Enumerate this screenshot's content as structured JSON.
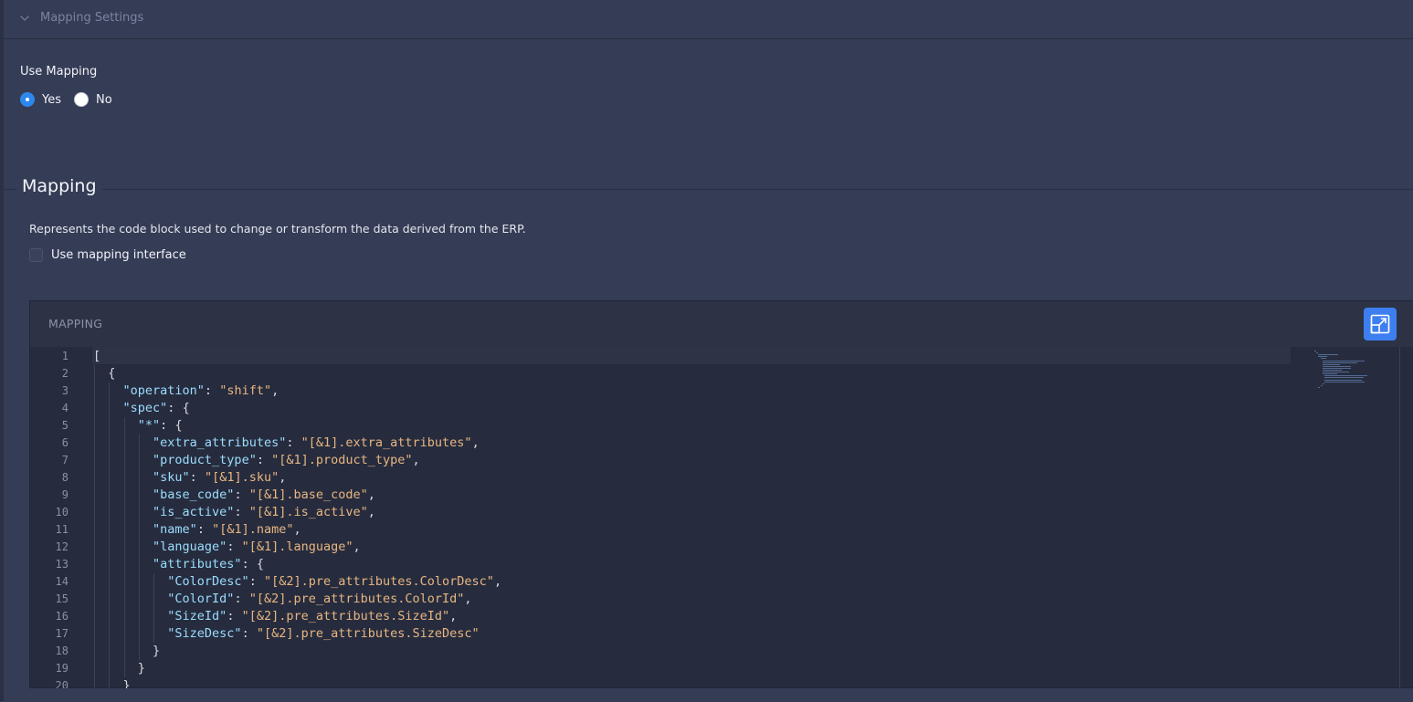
{
  "section": {
    "title": "Mapping Settings"
  },
  "use_mapping": {
    "label": "Use Mapping",
    "options": [
      {
        "label": "Yes",
        "checked": true
      },
      {
        "label": "No",
        "checked": false
      }
    ]
  },
  "mapping": {
    "legend": "Mapping",
    "description": "Represents the code block used to change or transform the data derived from the ERP.",
    "checkbox_label": "Use mapping interface",
    "checkbox_checked": false
  },
  "editor": {
    "title": "MAPPING",
    "line_numbers": [
      "1",
      "2",
      "3",
      "4",
      "5",
      "6",
      "7",
      "8",
      "9",
      "10",
      "11",
      "12",
      "13",
      "14",
      "15",
      "16",
      "17",
      "18",
      "19",
      "20"
    ],
    "code_lines": [
      "[",
      "  {",
      "    \"operation\": \"shift\",",
      "    \"spec\": {",
      "      \"*\": {",
      "        \"extra_attributes\": \"[&1].extra_attributes\",",
      "        \"product_type\": \"[&1].product_type\",",
      "        \"sku\": \"[&1].sku\",",
      "        \"base_code\": \"[&1].base_code\",",
      "        \"is_active\": \"[&1].is_active\",",
      "        \"name\": \"[&1].name\",",
      "        \"language\": \"[&1].language\",",
      "        \"attributes\": {",
      "          \"ColorDesc\": \"[&2].pre_attributes.ColorDesc\",",
      "          \"ColorId\": \"[&2].pre_attributes.ColorId\",",
      "          \"SizeId\": \"[&2].pre_attributes.SizeId\",",
      "          \"SizeDesc\": \"[&2].pre_attributes.SizeDesc\"",
      "        }",
      "      }",
      "    }"
    ]
  },
  "colors": {
    "background": "#353c55",
    "editor_bg": "#262c3e",
    "accent": "#3d7ff0",
    "radio_checked": "#2d88ee",
    "json_key": "#9cdcfe",
    "json_string": "#e8b580"
  },
  "icons": {
    "collapse": "chevron-down-icon",
    "expand": "expand-icon"
  }
}
